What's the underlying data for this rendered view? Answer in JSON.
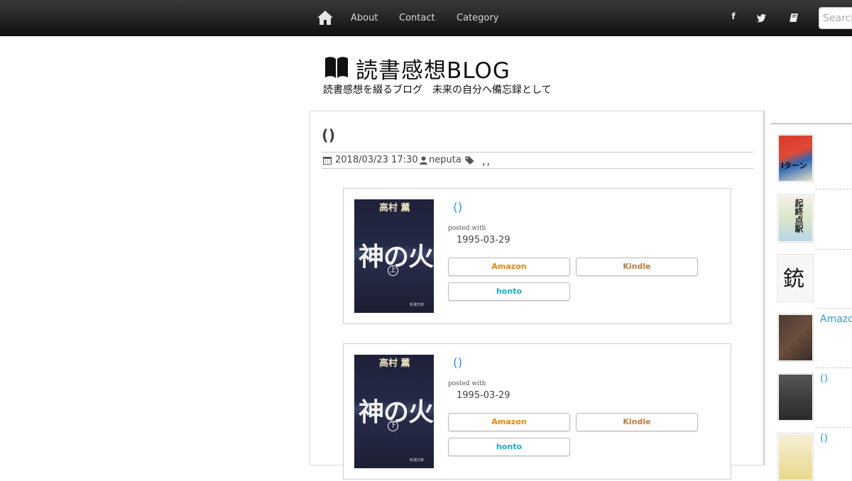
{
  "nav": {
    "links": [
      "About",
      "Contact",
      "Category"
    ],
    "search_placeholder": "Search"
  },
  "logo": {
    "title": "読書感想BLOG",
    "subtitle": "読書感想を綴るブログ　未来の自分へ備忘録として"
  },
  "post": {
    "title": "()",
    "date": "2018/03/23 17:30",
    "author": "neputa",
    "tags": "，，"
  },
  "books": [
    {
      "link": "()",
      "posted_with": "posted with",
      "pubdate": "1995-03-29",
      "cover": {
        "author": "高村 薫",
        "title": "神の火",
        "volume": "上",
        "publisher": "新潮文庫"
      },
      "buttons": {
        "amazon": "Amazon",
        "kindle": "Kindle",
        "honto": "honto"
      }
    },
    {
      "link": "()",
      "posted_with": "posted with",
      "pubdate": "1995-03-29",
      "cover": {
        "author": "高村 薫",
        "title": "神の火",
        "volume": "下",
        "publisher": "新潮文庫"
      },
      "buttons": {
        "amazon": "Amazon",
        "kindle": "Kindle",
        "honto": "honto"
      }
    }
  ],
  "sidebar": {
    "thumb_texts": [
      "Iターン",
      "起終点駅",
      "銃"
    ],
    "links": [
      "Amazo",
      "()",
      "()"
    ]
  },
  "colors": {
    "link": "#2a9bd6",
    "amazon": "#e5870c",
    "kindle": "#b77c3c",
    "honto": "#1aaac5",
    "navbar": "#1a1a1a"
  }
}
